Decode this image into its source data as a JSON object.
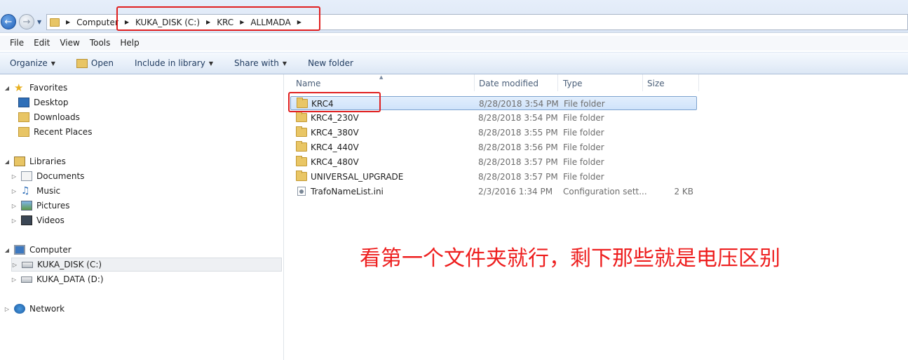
{
  "address": {
    "crumbs": [
      "Computer",
      "KUKA_DISK (C:)",
      "KRC",
      "ALLMADA"
    ]
  },
  "menu": [
    "File",
    "Edit",
    "View",
    "Tools",
    "Help"
  ],
  "toolbar": {
    "organize": "Organize",
    "open": "Open",
    "include": "Include in library",
    "share": "Share with",
    "new_folder": "New folder"
  },
  "nav": {
    "favorites": "Favorites",
    "desktop": "Desktop",
    "downloads": "Downloads",
    "recent": "Recent Places",
    "libraries": "Libraries",
    "documents": "Documents",
    "music": "Music",
    "pictures": "Pictures",
    "videos": "Videos",
    "computer": "Computer",
    "kuka_disk": "KUKA_DISK (C:)",
    "kuka_data": "KUKA_DATA (D:)",
    "network": "Network"
  },
  "columns": {
    "name": "Name",
    "date": "Date modified",
    "type": "Type",
    "size": "Size"
  },
  "files": [
    {
      "name": "KRC4",
      "date": "8/28/2018 3:54 PM",
      "type": "File folder",
      "size": "",
      "icon": "folder-icon"
    },
    {
      "name": "KRC4_230V",
      "date": "8/28/2018 3:54 PM",
      "type": "File folder",
      "size": "",
      "icon": "folder-icon"
    },
    {
      "name": "KRC4_380V",
      "date": "8/28/2018 3:55 PM",
      "type": "File folder",
      "size": "",
      "icon": "folder-icon"
    },
    {
      "name": "KRC4_440V",
      "date": "8/28/2018 3:56 PM",
      "type": "File folder",
      "size": "",
      "icon": "folder-icon"
    },
    {
      "name": "KRC4_480V",
      "date": "8/28/2018 3:57 PM",
      "type": "File folder",
      "size": "",
      "icon": "folder-icon"
    },
    {
      "name": "UNIVERSAL_UPGRADE",
      "date": "8/28/2018 3:57 PM",
      "type": "File folder",
      "size": "",
      "icon": "folder-icon"
    },
    {
      "name": "TrafoNameList.ini",
      "date": "2/3/2016 1:34 PM",
      "type": "Configuration sett...",
      "size": "2 KB",
      "icon": "config-file-icon"
    }
  ],
  "annotation": "看第一个文件夹就行，剩下那些就是电压区别",
  "colors": {
    "annotation": "#ee1f1f",
    "highlight_box": "#e02020",
    "selection_border": "#7da2ce"
  }
}
